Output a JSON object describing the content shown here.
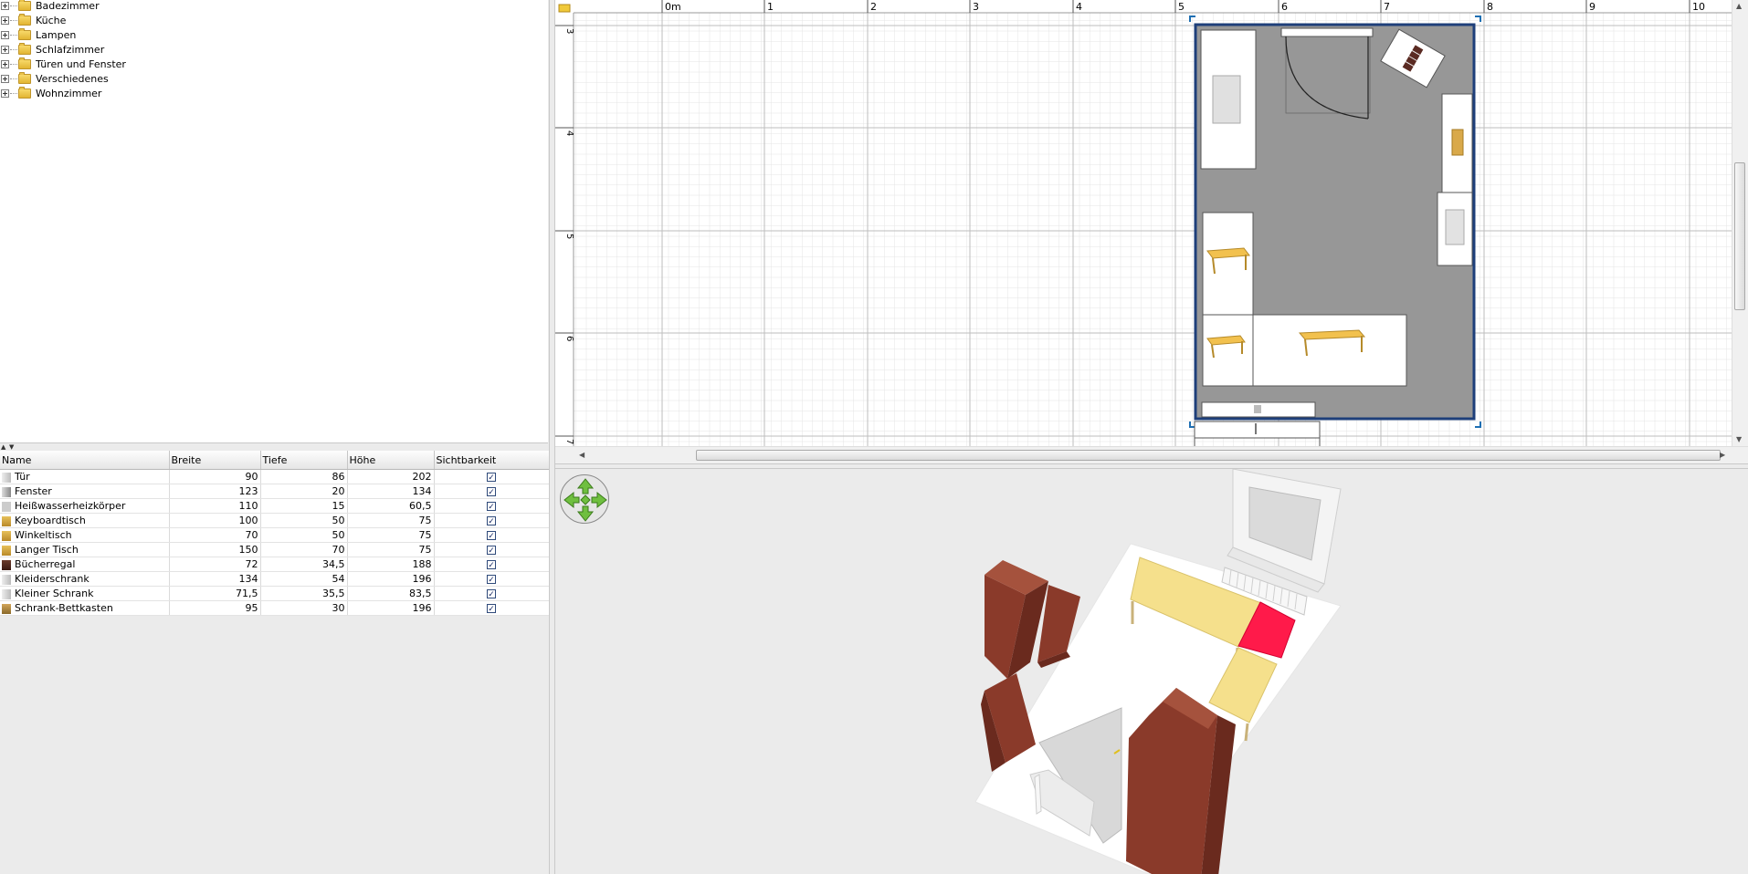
{
  "catalog": {
    "categories": [
      {
        "label": "Badezimmer"
      },
      {
        "label": "Küche"
      },
      {
        "label": "Lampen"
      },
      {
        "label": "Schlafzimmer"
      },
      {
        "label": "Türen und Fenster"
      },
      {
        "label": "Verschiedenes"
      },
      {
        "label": "Wohnzimmer"
      }
    ]
  },
  "furniture_table": {
    "columns": [
      "Name",
      "Breite",
      "Tiefe",
      "Höhe",
      "Sichtbarkeit"
    ],
    "rows": [
      {
        "name": "Tür",
        "width": "90",
        "depth": "86",
        "height": "202",
        "visible": "✓"
      },
      {
        "name": "Fenster",
        "width": "123",
        "depth": "20",
        "height": "134",
        "visible": "✓"
      },
      {
        "name": "Heißwasserheizkörper",
        "width": "110",
        "depth": "15",
        "height": "60,5",
        "visible": "✓"
      },
      {
        "name": "Keyboardtisch",
        "width": "100",
        "depth": "50",
        "height": "75",
        "visible": "✓"
      },
      {
        "name": "Winkeltisch",
        "width": "70",
        "depth": "50",
        "height": "75",
        "visible": "✓"
      },
      {
        "name": "Langer Tisch",
        "width": "150",
        "depth": "70",
        "height": "75",
        "visible": "✓"
      },
      {
        "name": "Bücherregal",
        "width": "72",
        "depth": "34,5",
        "height": "188",
        "visible": "✓"
      },
      {
        "name": "Kleiderschrank",
        "width": "134",
        "depth": "54",
        "height": "196",
        "visible": "✓"
      },
      {
        "name": "Kleiner Schrank",
        "width": "71,5",
        "depth": "35,5",
        "height": "83,5",
        "visible": "✓"
      },
      {
        "name": "Schrank-Bettkasten",
        "width": "95",
        "depth": "30",
        "height": "196",
        "visible": "✓"
      }
    ]
  },
  "plan": {
    "ruler_top_labels": [
      "0m",
      "1",
      "2",
      "3",
      "4",
      "5",
      "6",
      "7",
      "8",
      "9",
      "10"
    ],
    "ruler_left_labels": [
      "3",
      "4",
      "5",
      "6",
      "7"
    ],
    "selection_color": "#1e3f7a",
    "room_color": "#979797"
  },
  "colors": {
    "desk": "#f5e08c",
    "selected_red": "#ff1a4a",
    "cabinet_brown": "#8a3a2a",
    "nav_green": "#6fbf3f"
  },
  "icons": {
    "folder": "folder-icon",
    "nav": "navigation-arrows-icon"
  }
}
